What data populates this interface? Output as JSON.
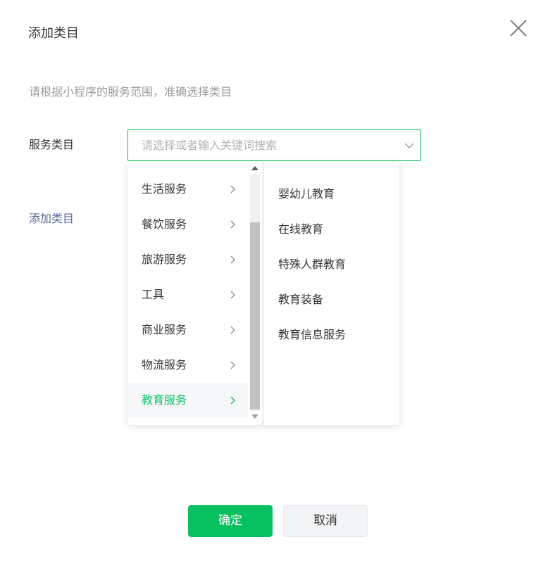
{
  "dialog": {
    "title": "添加类目",
    "hint": "请根据小程序的服务范围，准确选择类目",
    "field_label": "服务类目",
    "add_link": "添加类目",
    "close_icon": "close-icon"
  },
  "select": {
    "placeholder": "请选择或者输入关键词搜索",
    "icon": "chevron-down-icon"
  },
  "categories": [
    {
      "label": "生活服务",
      "active": false
    },
    {
      "label": "餐饮服务",
      "active": false
    },
    {
      "label": "旅游服务",
      "active": false
    },
    {
      "label": "工具",
      "active": false
    },
    {
      "label": "商业服务",
      "active": false
    },
    {
      "label": "物流服务",
      "active": false
    },
    {
      "label": "教育服务",
      "active": true
    }
  ],
  "subcategories": [
    {
      "label": "婴幼儿教育"
    },
    {
      "label": "在线教育"
    },
    {
      "label": "特殊人群教育"
    },
    {
      "label": "教育装备"
    },
    {
      "label": "教育信息服务"
    }
  ],
  "buttons": {
    "confirm": "确定",
    "cancel": "取消"
  },
  "colors": {
    "accent": "#07c160",
    "link": "#576b95",
    "hint": "#9a9a9a"
  }
}
